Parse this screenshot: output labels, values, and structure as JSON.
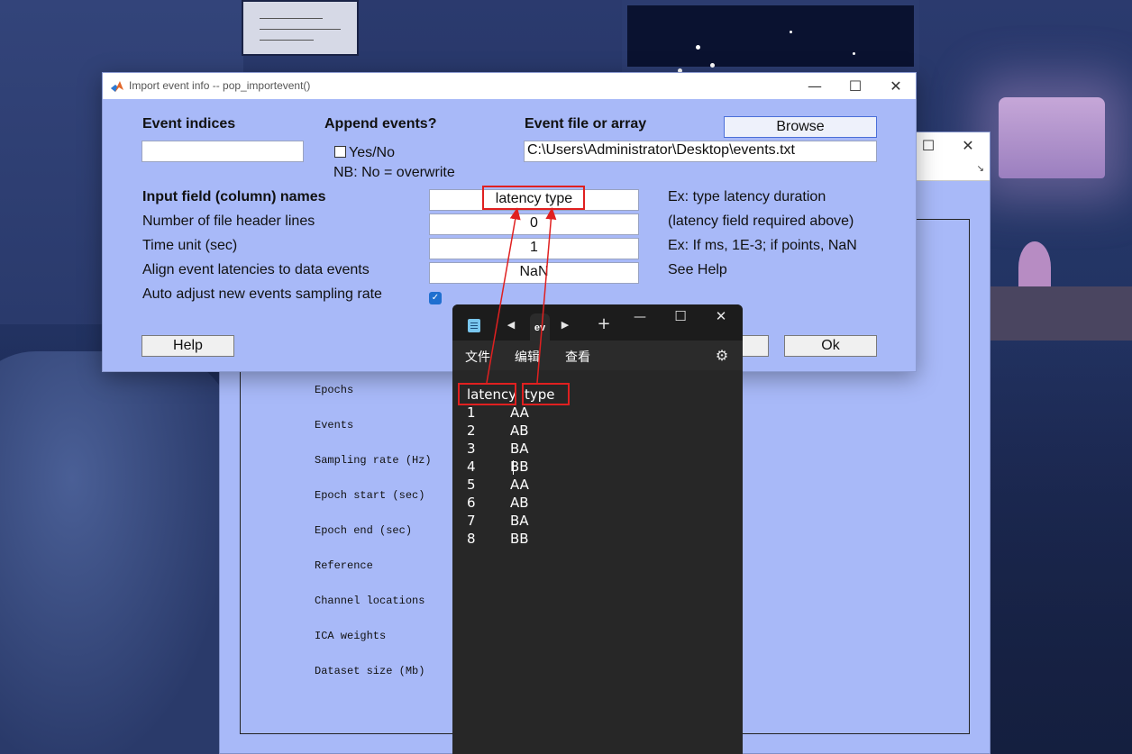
{
  "dialog": {
    "title": "Import event info -- pop_importevent()",
    "event_indices_label": "Event indices",
    "event_indices_value": "",
    "append_label": "Append events?",
    "append_checkbox_label": "Yes/No",
    "append_checked": false,
    "append_note": "NB: No = overwrite",
    "event_file_label": "Event file or array",
    "browse_button": "Browse",
    "event_file_value": "C:\\Users\\Administrator\\Desktop\\events.txt",
    "fields_label": "Input field (column) names",
    "fields_value": "latency type",
    "fields_hint": "Ex: type latency duration",
    "header_lines_label": "Number of file header lines",
    "header_lines_value": "0",
    "header_lines_hint": "(latency field required above)",
    "time_unit_label": "Time unit (sec)",
    "time_unit_value": "1",
    "time_unit_hint": "Ex: If ms, 1E-3; if points, NaN",
    "align_label": "Align event latencies to data events",
    "align_value": "NaN",
    "align_hint": "See Help",
    "auto_adjust_label": "Auto adjust new events sampling rate",
    "auto_adjust_checked": true,
    "help_button": "Help",
    "ok_button": "Ok"
  },
  "main_window": {
    "fields": [
      "Epochs",
      "Events",
      "Sampling rate (Hz)",
      "Epoch start (sec)",
      "Epoch end (sec)",
      "Reference",
      "Channel locations",
      "ICA weights",
      "Dataset size (Mb)"
    ]
  },
  "notepad": {
    "tab_label": "ev",
    "menu": [
      "文件",
      "编辑",
      "查看"
    ],
    "header": [
      "latency",
      "type"
    ],
    "rows": [
      [
        "1",
        "AA"
      ],
      [
        "2",
        "AB"
      ],
      [
        "3",
        "BA"
      ],
      [
        "4",
        "BB"
      ],
      [
        "5",
        "AA"
      ],
      [
        "6",
        "AB"
      ],
      [
        "7",
        "BA"
      ],
      [
        "8",
        "BB"
      ]
    ]
  },
  "colors": {
    "dialog_bg": "#a8b9f8",
    "annotation_red": "#e02020",
    "notepad_bg": "#272727"
  },
  "icons": [
    "matlab-icon",
    "minimize-icon",
    "maximize-icon",
    "close-icon",
    "notepad-icon",
    "chevron-left-icon",
    "chevron-right-icon",
    "plus-icon",
    "settings-gear-icon",
    "checkmark-icon"
  ]
}
